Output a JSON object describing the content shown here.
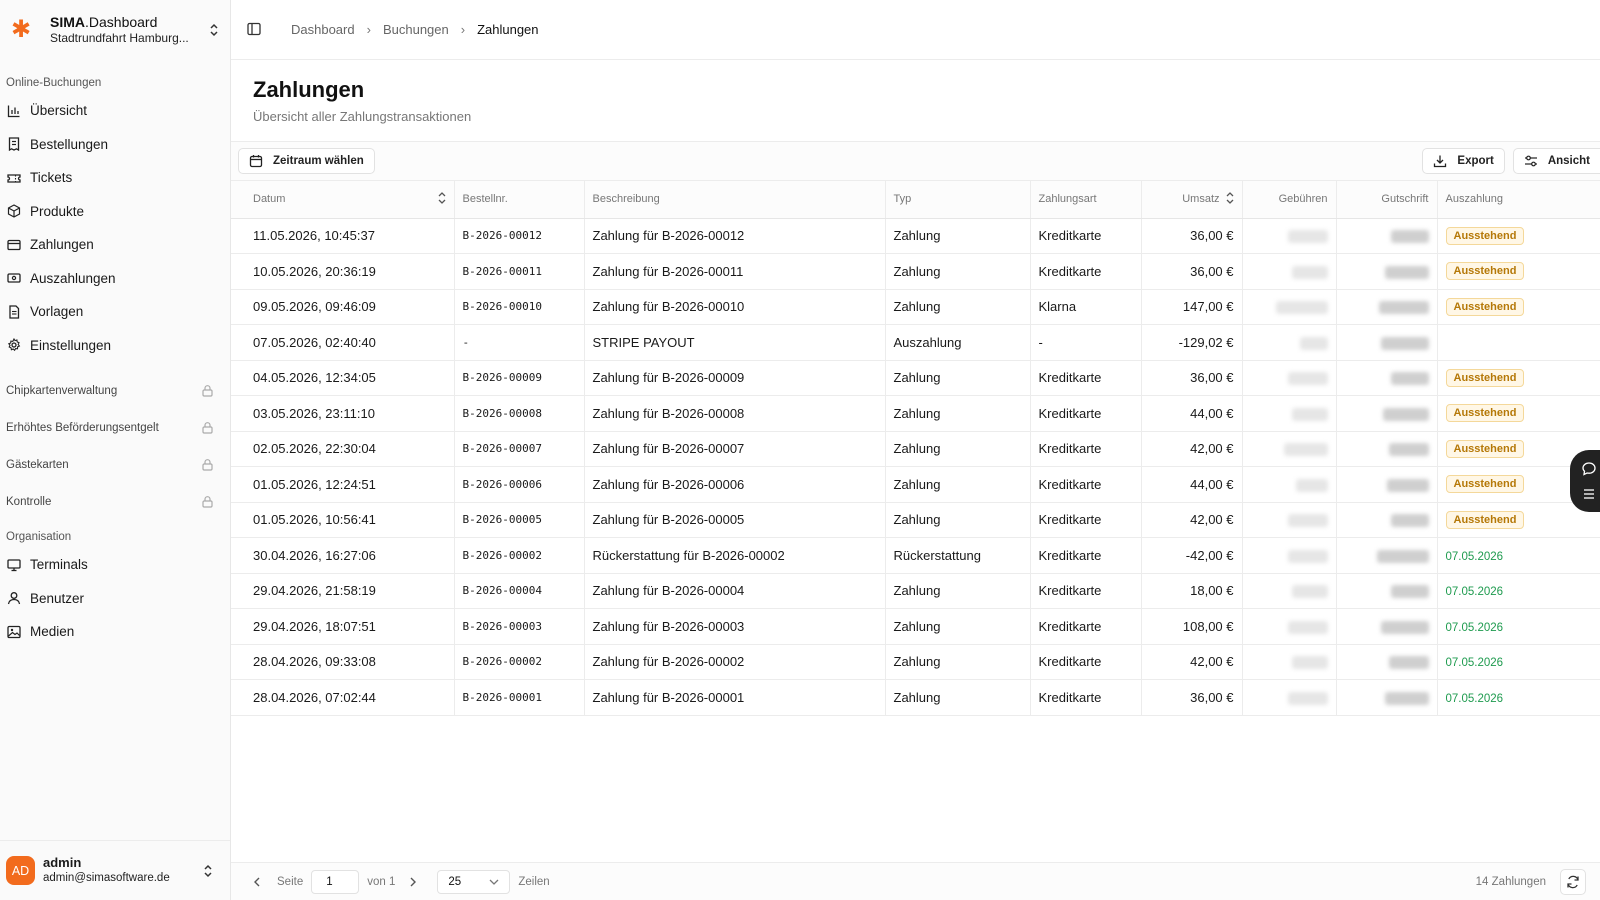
{
  "brand": {
    "title_main": "SIMA",
    "title_rest": ".Dashboard",
    "subtitle": "Stadtrundfahrt Hamburg...",
    "accent": "#f26b1d"
  },
  "sidebar": {
    "section_online": "Online-Buchungen",
    "items": [
      {
        "label": "Übersicht",
        "icon": "bar-chart-icon"
      },
      {
        "label": "Bestellungen",
        "icon": "receipt-icon"
      },
      {
        "label": "Tickets",
        "icon": "ticket-icon"
      },
      {
        "label": "Produkte",
        "icon": "package-icon"
      },
      {
        "label": "Zahlungen",
        "icon": "credit-card-icon"
      },
      {
        "label": "Auszahlungen",
        "icon": "banknote-icon"
      },
      {
        "label": "Vorlagen",
        "icon": "file-icon"
      },
      {
        "label": "Einstellungen",
        "icon": "gear-icon"
      }
    ],
    "locked": [
      {
        "label": "Chipkartenverwaltung"
      },
      {
        "label": "Erhöhtes Beförderungsentgelt"
      },
      {
        "label": "Gästekarten"
      },
      {
        "label": "Kontrolle"
      }
    ],
    "section_org": "Organisation",
    "org_items": [
      {
        "label": "Terminals",
        "icon": "monitor-icon"
      },
      {
        "label": "Benutzer",
        "icon": "user-icon"
      },
      {
        "label": "Medien",
        "icon": "image-icon"
      }
    ]
  },
  "user": {
    "initials": "AD",
    "name": "admin",
    "email": "admin@simasoftware.de"
  },
  "breadcrumb": [
    "Dashboard",
    "Buchungen",
    "Zahlungen"
  ],
  "page": {
    "title": "Zahlungen",
    "subtitle": "Übersicht aller Zahlungstransaktionen"
  },
  "toolbar": {
    "date_range": "Zeitraum wählen",
    "export": "Export",
    "view": "Ansicht"
  },
  "table": {
    "headers": {
      "datum": "Datum",
      "bestellnr": "Bestellnr.",
      "beschreibung": "Beschreibung",
      "typ": "Typ",
      "zahlungsart": "Zahlungsart",
      "umsatz": "Umsatz",
      "gebuehren": "Gebühren",
      "gutschrift": "Gutschrift",
      "auszahlung": "Auszahlung"
    },
    "rows": [
      {
        "datum": "11.05.2026, 10:45:37",
        "nr": "B-2026-00012",
        "desc": "Zahlung für B-2026-00012",
        "typ": "Zahlung",
        "art": "Kreditkarte",
        "umsatz": "36,00 €",
        "status": "Ausstehend"
      },
      {
        "datum": "10.05.2026, 20:36:19",
        "nr": "B-2026-00011",
        "desc": "Zahlung für B-2026-00011",
        "typ": "Zahlung",
        "art": "Kreditkarte",
        "umsatz": "36,00 €",
        "status": "Ausstehend"
      },
      {
        "datum": "09.05.2026, 09:46:09",
        "nr": "B-2026-00010",
        "desc": "Zahlung für B-2026-00010",
        "typ": "Zahlung",
        "art": "Klarna",
        "umsatz": "147,00 €",
        "status": "Ausstehend"
      },
      {
        "datum": "07.05.2026, 02:40:40",
        "nr": "-",
        "desc": "STRIPE PAYOUT",
        "typ": "Auszahlung",
        "art": "-",
        "umsatz": "-129,02 €",
        "status": ""
      },
      {
        "datum": "04.05.2026, 12:34:05",
        "nr": "B-2026-00009",
        "desc": "Zahlung für B-2026-00009",
        "typ": "Zahlung",
        "art": "Kreditkarte",
        "umsatz": "36,00 €",
        "status": "Ausstehend"
      },
      {
        "datum": "03.05.2026, 23:11:10",
        "nr": "B-2026-00008",
        "desc": "Zahlung für B-2026-00008",
        "typ": "Zahlung",
        "art": "Kreditkarte",
        "umsatz": "44,00 €",
        "status": "Ausstehend"
      },
      {
        "datum": "02.05.2026, 22:30:04",
        "nr": "B-2026-00007",
        "desc": "Zahlung für B-2026-00007",
        "typ": "Zahlung",
        "art": "Kreditkarte",
        "umsatz": "42,00 €",
        "status": "Ausstehend"
      },
      {
        "datum": "01.05.2026, 12:24:51",
        "nr": "B-2026-00006",
        "desc": "Zahlung für B-2026-00006",
        "typ": "Zahlung",
        "art": "Kreditkarte",
        "umsatz": "44,00 €",
        "status": "Ausstehend"
      },
      {
        "datum": "01.05.2026, 10:56:41",
        "nr": "B-2026-00005",
        "desc": "Zahlung für B-2026-00005",
        "typ": "Zahlung",
        "art": "Kreditkarte",
        "umsatz": "42,00 €",
        "status": "Ausstehend"
      },
      {
        "datum": "30.04.2026, 16:27:06",
        "nr": "B-2026-00002",
        "desc": "Rückerstattung für B-2026-00002",
        "typ": "Rückerstattung",
        "art": "Kreditkarte",
        "umsatz": "-42,00 €",
        "status": "07.05.2026"
      },
      {
        "datum": "29.04.2026, 21:58:19",
        "nr": "B-2026-00004",
        "desc": "Zahlung für B-2026-00004",
        "typ": "Zahlung",
        "art": "Kreditkarte",
        "umsatz": "18,00 €",
        "status": "07.05.2026"
      },
      {
        "datum": "29.04.2026, 18:07:51",
        "nr": "B-2026-00003",
        "desc": "Zahlung für B-2026-00003",
        "typ": "Zahlung",
        "art": "Kreditkarte",
        "umsatz": "108,00 €",
        "status": "07.05.2026"
      },
      {
        "datum": "28.04.2026, 09:33:08",
        "nr": "B-2026-00002",
        "desc": "Zahlung für B-2026-00002",
        "typ": "Zahlung",
        "art": "Kreditkarte",
        "umsatz": "42,00 €",
        "status": "07.05.2026"
      },
      {
        "datum": "28.04.2026, 07:02:44",
        "nr": "B-2026-00001",
        "desc": "Zahlung für B-2026-00001",
        "typ": "Zahlung",
        "art": "Kreditkarte",
        "umsatz": "36,00 €",
        "status": "07.05.2026"
      }
    ]
  },
  "pagination": {
    "page_label": "Seite",
    "page_value": "1",
    "of_label": "von 1",
    "page_size": "25",
    "rows_label": "Zeilen",
    "total": "14 Zahlungen"
  },
  "colors": {
    "pending_text": "#b57807",
    "pending_bg": "#fff7e6",
    "paid_text": "#1f9b4f"
  }
}
